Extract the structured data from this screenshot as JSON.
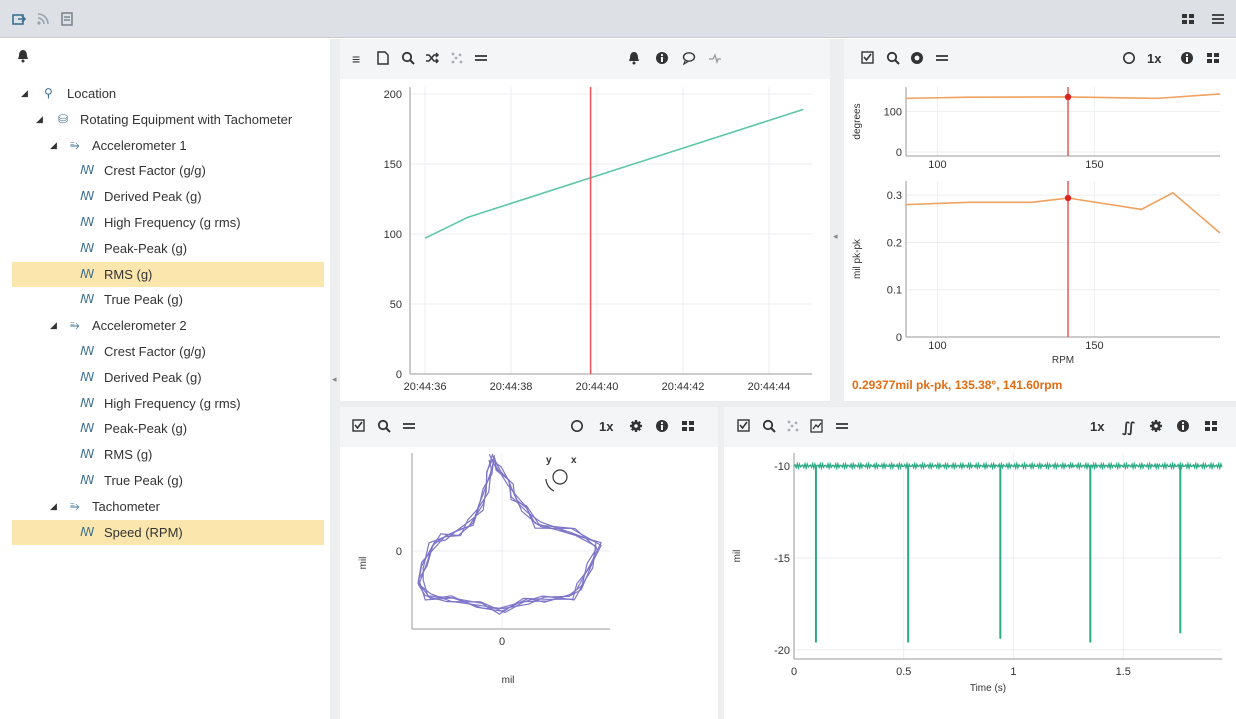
{
  "tree": {
    "items": [
      {
        "label": "Location",
        "icon": "location-pin-icon",
        "level": 0
      },
      {
        "label": "Rotating Equipment with Tachometer",
        "icon": "equipment-icon",
        "level": 1
      },
      {
        "label": "Accelerometer 1",
        "icon": "sensor-icon",
        "level": 2
      },
      {
        "label": "Crest Factor (g/g)",
        "icon": "waveform-icon",
        "level": 3
      },
      {
        "label": "Derived Peak (g)",
        "icon": "waveform-icon",
        "level": 3
      },
      {
        "label": "High Frequency (g rms)",
        "icon": "waveform-icon",
        "level": 3
      },
      {
        "label": "Peak-Peak (g)",
        "icon": "waveform-icon",
        "level": 3
      },
      {
        "label": "RMS (g)",
        "icon": "waveform-icon",
        "level": 3,
        "selected": true
      },
      {
        "label": "True Peak (g)",
        "icon": "waveform-icon",
        "level": 3
      },
      {
        "label": "Accelerometer 2",
        "icon": "sensor-icon",
        "level": 2
      },
      {
        "label": "Crest Factor (g/g)",
        "icon": "waveform-icon",
        "level": 3
      },
      {
        "label": "Derived Peak (g)",
        "icon": "waveform-icon",
        "level": 3
      },
      {
        "label": "High Frequency (g rms)",
        "icon": "waveform-icon",
        "level": 3
      },
      {
        "label": "Peak-Peak (g)",
        "icon": "waveform-icon",
        "level": 3
      },
      {
        "label": "RMS (g)",
        "icon": "waveform-icon",
        "level": 3
      },
      {
        "label": "True Peak (g)",
        "icon": "waveform-icon",
        "level": 3
      },
      {
        "label": "Tachometer",
        "icon": "sensor-icon",
        "level": 2
      },
      {
        "label": "Speed (RPM)",
        "icon": "waveform-icon",
        "level": 3,
        "selected": true
      }
    ]
  },
  "toolbars": {
    "trend": {
      "speed": ""
    },
    "bode": {
      "speed": "1x"
    },
    "orbit": {
      "speed": "1x"
    },
    "waveform": {
      "speed": "1x"
    }
  },
  "colors": {
    "trend_line": "#5cc6a6",
    "cursor": "#e8585c",
    "bode_line": "#f0a15e",
    "orbit": "#7d75c7",
    "waveform": "#2bab84"
  },
  "bode_readout": "0.29377mil pk-pk, 135.38°, 141.60rpm",
  "chart_data": [
    {
      "id": "trend",
      "type": "line",
      "x": [
        "20:44:36",
        "20:44:37",
        "20:44:44.8"
      ],
      "xticks": [
        "20:44:36",
        "20:44:38",
        "20:44:40",
        "20:44:42",
        "20:44:44"
      ],
      "yticks": [
        "0",
        "50",
        "100",
        "150",
        "200"
      ],
      "ylim": [
        0,
        205
      ],
      "series": [
        {
          "values": [
            [
              0,
              97
            ],
            [
              1,
              112
            ],
            [
              8.8,
              189
            ]
          ]
        }
      ],
      "cursor_x": 3.85,
      "grid": true
    },
    {
      "id": "bode_phase",
      "type": "line",
      "ylabel": "degrees",
      "xticks": [
        "100",
        "150"
      ],
      "yticks": [
        "0",
        "100"
      ],
      "xlim": [
        90,
        190
      ],
      "ylim": [
        -10,
        160
      ],
      "series": [
        {
          "values": [
            [
              90,
              132
            ],
            [
              110,
              135
            ],
            [
              141.6,
              135.4
            ],
            [
              170,
              132
            ],
            [
              190,
              143
            ]
          ]
        }
      ],
      "cursor_x": 141.6,
      "grid": true
    },
    {
      "id": "bode_amplitude",
      "type": "line",
      "xlabel": "RPM",
      "ylabel": "mil pk-pk",
      "xticks": [
        "100",
        "150"
      ],
      "yticks": [
        "0",
        "0.1",
        "0.2",
        "0.3"
      ],
      "xlim": [
        90,
        190
      ],
      "ylim": [
        0,
        0.33
      ],
      "series": [
        {
          "values": [
            [
              90,
              0.28
            ],
            [
              110,
              0.285
            ],
            [
              130,
              0.285
            ],
            [
              141.6,
              0.294
            ],
            [
              165,
              0.27
            ],
            [
              175,
              0.305
            ],
            [
              190,
              0.22
            ]
          ]
        }
      ],
      "cursor_x": 141.6,
      "grid": true
    },
    {
      "id": "orbit",
      "type": "scatter",
      "xlabel": "mil",
      "ylabel": "mil",
      "xticks": [
        "0"
      ],
      "yticks": [
        "0"
      ],
      "direction_labels": [
        "y",
        "x"
      ],
      "grid": true
    },
    {
      "id": "waveform",
      "type": "line",
      "xlabel": "Time (s)",
      "ylabel": "mil",
      "xticks": [
        "0",
        "0.5",
        "1",
        "1.5"
      ],
      "yticks": [
        "-10",
        "-15",
        "-20"
      ],
      "xlim": [
        0,
        1.95
      ],
      "ylim": [
        -20.5,
        -9.3
      ],
      "baseline": -10,
      "dips": [
        {
          "t": 0.1,
          "v": -19.6
        },
        {
          "t": 0.52,
          "v": -19.6
        },
        {
          "t": 0.94,
          "v": -19.4
        },
        {
          "t": 1.35,
          "v": -19.6
        },
        {
          "t": 1.76,
          "v": -19.1
        }
      ],
      "grid": true
    }
  ]
}
